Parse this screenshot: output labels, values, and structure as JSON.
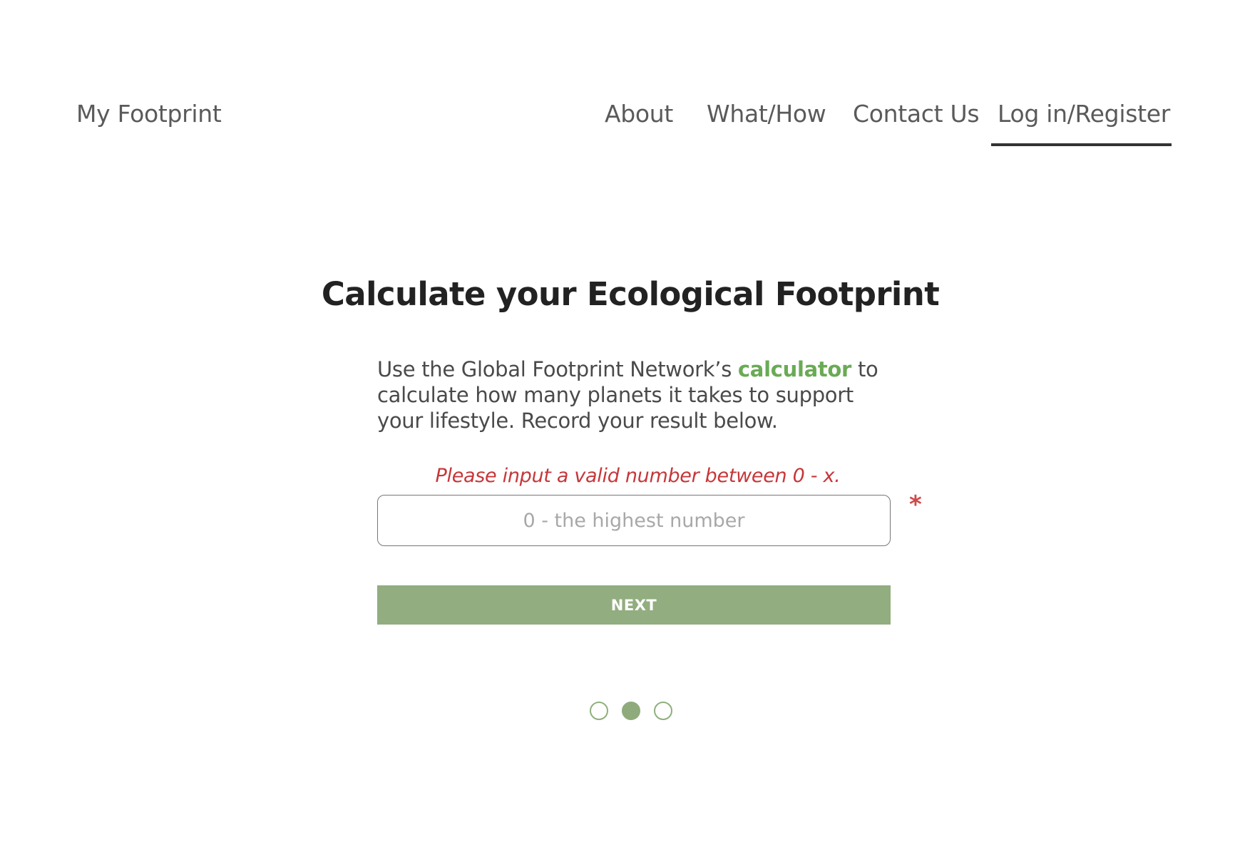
{
  "header": {
    "brand": "My Footprint",
    "nav": {
      "about": "About",
      "what_how": "What/How",
      "contact": "Contact Us",
      "login": "Log in/Register"
    },
    "active_nav": "login"
  },
  "main": {
    "title": "Calculate your Ecological Footprint",
    "intro": {
      "before_link": "Use the Global Footprint Network’s ",
      "link": "calculator",
      "after_link": " to calculate how many planets it takes to support your lifestyle. Record your result below."
    },
    "error_message": "Please input a valid number between 0 - x.",
    "input": {
      "placeholder": "0 - the highest number",
      "value": ""
    },
    "required_marker": "*",
    "next_label": "NEXT"
  },
  "pagination": {
    "total": 3,
    "active": 2
  },
  "colors": {
    "accent_green": "#92ad7f",
    "link_green": "#6aaa55",
    "error_red": "#c6373a"
  }
}
